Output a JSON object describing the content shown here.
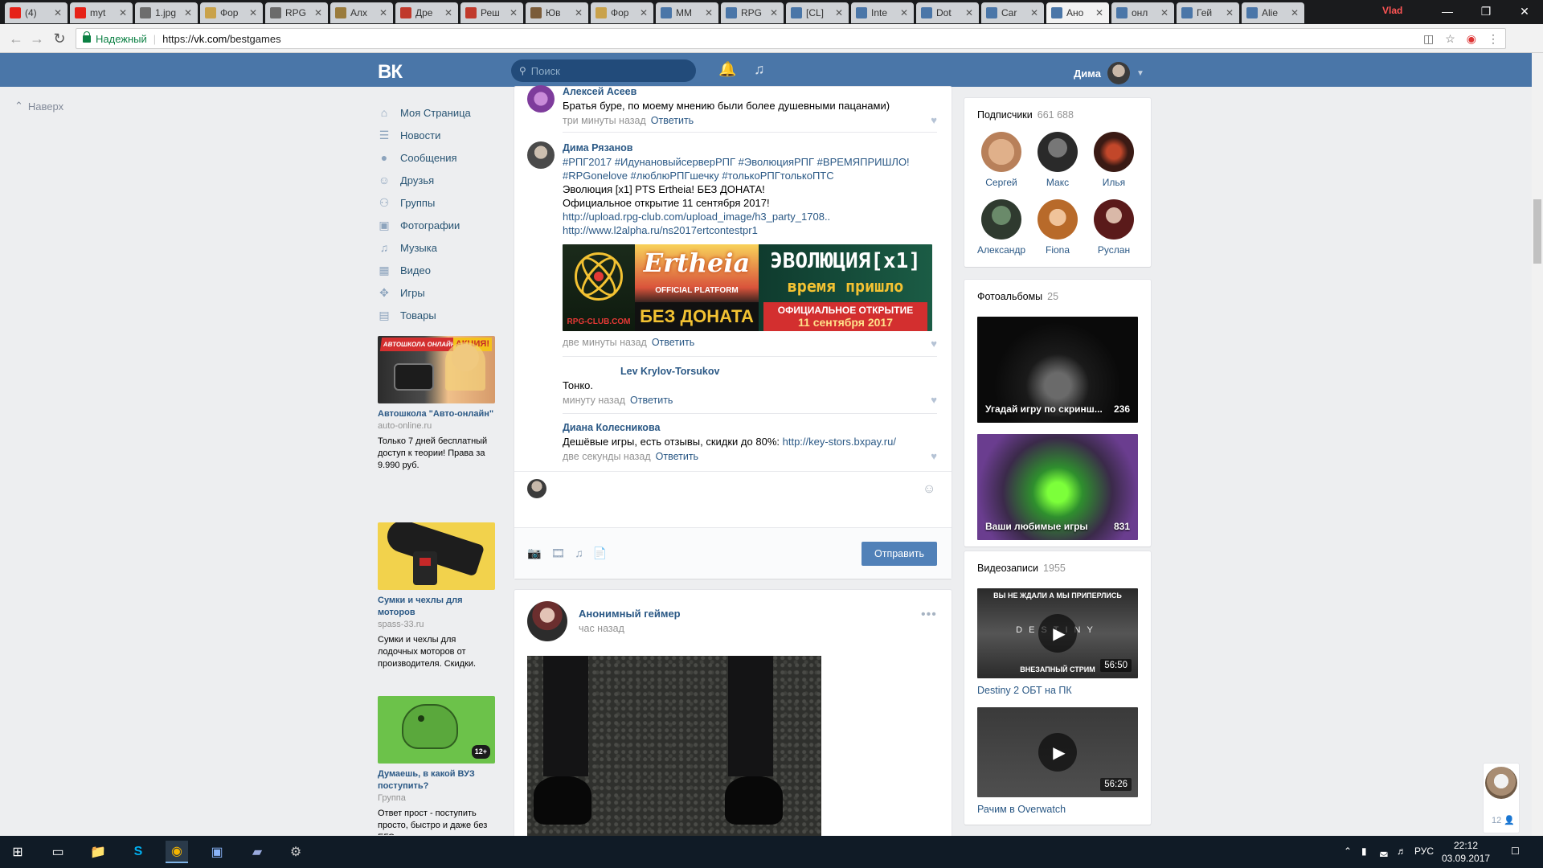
{
  "browser": {
    "tabs": [
      {
        "title": "(4)",
        "color": "#e62117"
      },
      {
        "title": "myt",
        "color": "#e62117"
      },
      {
        "title": "1.jpg",
        "color": "#6d6d6d"
      },
      {
        "title": "Фор",
        "color": "#c9a24b"
      },
      {
        "title": "RPG",
        "color": "#6b6b6b"
      },
      {
        "title": "Алх",
        "color": "#9a7b3c"
      },
      {
        "title": "Дре",
        "color": "#c0392b"
      },
      {
        "title": "Реш",
        "color": "#c0392b"
      },
      {
        "title": "Юв",
        "color": "#7b5c3a"
      },
      {
        "title": "Фор",
        "color": "#c9a24b"
      },
      {
        "title": "ММ",
        "color": "#4a76a8"
      },
      {
        "title": "RPG",
        "color": "#4a76a8"
      },
      {
        "title": "[CL]",
        "color": "#4a76a8"
      },
      {
        "title": "Inte",
        "color": "#4a76a8"
      },
      {
        "title": "Dot",
        "color": "#4a76a8"
      },
      {
        "title": "Car",
        "color": "#4a76a8"
      },
      {
        "title": "Ано",
        "color": "#4a76a8"
      },
      {
        "title": "онл",
        "color": "#4a76a8"
      },
      {
        "title": "Гей",
        "color": "#4a76a8"
      },
      {
        "title": "Alie",
        "color": "#4a76a8"
      }
    ],
    "profile_chip": "Vlad",
    "secure_label": "Надежный",
    "url_scheme": "https://",
    "url_host": "vk.com",
    "url_path": "/bestgames"
  },
  "header": {
    "logo": "ВК",
    "search_placeholder": "Поиск",
    "user_name": "Дима"
  },
  "left": {
    "back_to_top": "Наверх",
    "nav": [
      {
        "label": "Моя Страница",
        "icon": "home-icon"
      },
      {
        "label": "Новости",
        "icon": "news-icon"
      },
      {
        "label": "Сообщения",
        "icon": "messages-icon"
      },
      {
        "label": "Друзья",
        "icon": "friends-icon"
      },
      {
        "label": "Группы",
        "icon": "groups-icon"
      },
      {
        "label": "Фотографии",
        "icon": "camera-icon"
      },
      {
        "label": "Музыка",
        "icon": "music-icon"
      },
      {
        "label": "Видео",
        "icon": "video-icon"
      },
      {
        "label": "Игры",
        "icon": "gamepad-icon"
      },
      {
        "label": "Товары",
        "icon": "bag-icon"
      }
    ],
    "ads": [
      {
        "banner_top": "АВТОШКОЛА ОНЛАЙН",
        "banner_promo": "АКЦИЯ!",
        "title": "Автошкола \"Авто-онлайн\"",
        "domain": "auto-online.ru",
        "text": "Только 7 дней бесплатный доступ к теории! Права за 9.990 руб."
      },
      {
        "title": "Сумки и чехлы для моторов",
        "domain": "spass-33.ru",
        "text": "Сумки и чехлы для лодочных моторов от производителя. Скидки."
      },
      {
        "age_badge": "12+",
        "title": "Думаешь, в какой ВУЗ поступить?",
        "domain": "Группа",
        "text": "Ответ прост - поступить просто, быстро и даже без ЕГЭ можно в..."
      }
    ]
  },
  "feed": {
    "comments": [
      {
        "author": "Алексей Асеев",
        "text": "Братья буре, по моему мнению были более душевными пацанами)",
        "time": "три минуты назад",
        "reply": "Ответить"
      },
      {
        "author": "Дима Рязанов",
        "hashtags_line1": "#РПГ2017 #ИдунановыйсерверРПГ #ЭволюцияРПГ #ВРЕМЯПРИШЛО!",
        "hashtags_line2": "#RPGonelove #люблюРПГшечку #толькоРПГтолькоПТС",
        "line3": "Эволюция [x1] PTS Ertheia! БЕЗ ДОНАТА!",
        "line4": "Официальное открытие 11 сентября 2017!",
        "link1": "http://upload.rpg-club.com/upload_image/h3_party_1708..",
        "link2": "http://www.l2alpha.ru/ns2017ertcontestpr1",
        "banner": {
          "left_caption": "RPG-CLUB.COM",
          "mid_title": "Ertheia",
          "mid_sub": "OFFICIAL PLATFORM",
          "mid_bottom": "БЕЗ ДОНАТА",
          "right_title": "ЭВОЛЮЦИЯ[x1]",
          "right_sub": "время пришло",
          "right_bottom1": "ОФИЦИАЛЬНОЕ ОТКРЫТИЕ",
          "right_bottom2": "11 сентября 2017"
        },
        "time": "две минуты назад",
        "reply": "Ответить"
      },
      {
        "author": "Lev Krylov-Torsukov",
        "text": "Тонко.",
        "time": "минуту назад",
        "reply": "Ответить"
      },
      {
        "author": "Диана Колесникова",
        "text": "Дешёвые игры, есть отзывы, скидки до 80%: ",
        "link": "http://key-stors.bxpay.ru/",
        "time": "две секунды назад",
        "reply": "Ответить"
      }
    ],
    "send_button": "Отправить",
    "post": {
      "author": "Анонимный геймер",
      "time": "час назад"
    }
  },
  "right": {
    "subscribers": {
      "title": "Подписчики",
      "count": "661 688",
      "people": [
        "Сергей",
        "Макс",
        "Илья",
        "Александр",
        "Fiona",
        "Руслан"
      ]
    },
    "albums": {
      "title": "Фотоальбомы",
      "count": "25",
      "items": [
        {
          "title": "Угадай игру по скринш...",
          "count": "236"
        },
        {
          "title": "Ваши любимые игры",
          "count": "831"
        }
      ]
    },
    "videos": {
      "title": "Видеозаписи",
      "count": "1955",
      "items": [
        {
          "title": "Destiny 2 ОБТ на ПК",
          "duration": "56:50",
          "overlay_top": "ВЫ НЕ ЖДАЛИ А МЫ ПРИПЕРЛИСЬ",
          "overlay_mid": "DESTINY",
          "overlay_bottom": "ВНЕЗАПНЫЙ СТРИМ"
        },
        {
          "title": "Рачим в Overwatch",
          "duration": "56:26"
        }
      ]
    },
    "chat_count": "12"
  },
  "taskbar": {
    "lang": "РУС",
    "time": "22:12",
    "date": "03.09.2017"
  }
}
